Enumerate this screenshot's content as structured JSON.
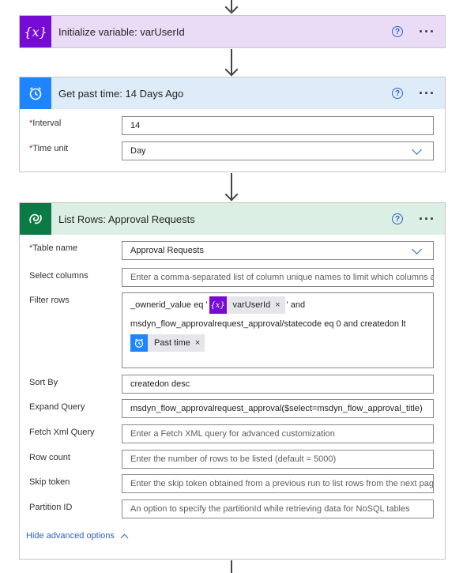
{
  "steps": {
    "initialize": {
      "title": "Initialize variable: varUserId",
      "icon": "variable-icon",
      "color": "#770bd6",
      "header_bg": "#eadcf7"
    },
    "past_time": {
      "title": "Get past time: 14 Days Ago",
      "icon": "alarm-clock-icon",
      "color": "#1f85ff",
      "header_bg": "#deecfa",
      "interval": {
        "label": "Interval",
        "value": "14"
      },
      "time_unit": {
        "label": "Time unit",
        "value": "Day"
      }
    },
    "list_rows": {
      "title": "List Rows: Approval Requests",
      "icon": "dataverse-icon",
      "color": "#0b7a45",
      "header_bg": "#dcefe5",
      "table_name": {
        "label": "Table name",
        "value": "Approval Requests"
      },
      "select_columns": {
        "label": "Select columns",
        "placeholder": "Enter a comma-separated list of column unique names to limit which columns a"
      },
      "filter_rows": {
        "label": "Filter rows",
        "line1_prefix": "_ownerid_value eq '",
        "token1": "varUserId",
        "line1_suffix": "' and",
        "line2": "msdyn_flow_approvalrequest_approval/statecode eq 0 and createdon lt",
        "token2": "Past time",
        "token_close": "×"
      },
      "sort_by": {
        "label": "Sort By",
        "value": "createdon desc"
      },
      "expand_query": {
        "label": "Expand Query",
        "value": "msdyn_flow_approvalrequest_approval($select=msdyn_flow_approval_title)"
      },
      "fetch_xml": {
        "label": "Fetch Xml Query",
        "placeholder": "Enter a Fetch XML query for advanced customization"
      },
      "row_count": {
        "label": "Row count",
        "placeholder": "Enter the number of rows to be listed (default = 5000)"
      },
      "skip_token": {
        "label": "Skip token",
        "placeholder": "Enter the skip token obtained from a previous run to list rows from the next pag"
      },
      "partition_id": {
        "label": "Partition ID",
        "placeholder": "An option to specify the partitionId while retrieving data for NoSQL tables"
      },
      "hide_advanced": "Hide advanced options"
    }
  },
  "common": {
    "help": "?",
    "more": "···",
    "required_mark": "*"
  }
}
